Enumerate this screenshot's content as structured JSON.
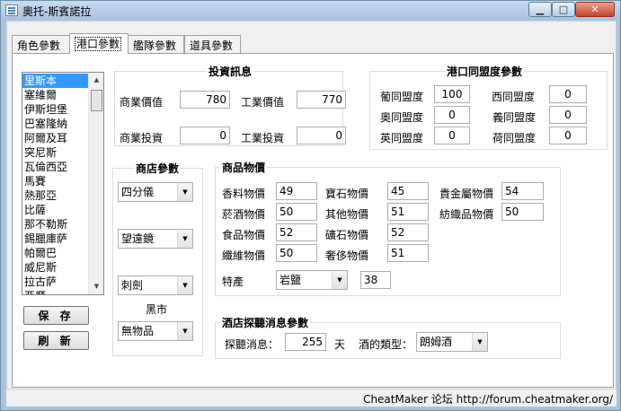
{
  "window": {
    "title": "奧托-斯賓諾拉"
  },
  "status": {
    "text": "CheatMaker 论坛 http://forum.cheatmaker.org/"
  },
  "tabs": [
    {
      "label": "角色參數"
    },
    {
      "label": "港口參數"
    },
    {
      "label": "艦隊參數"
    },
    {
      "label": "道具參數"
    }
  ],
  "ports": [
    "里斯本",
    "塞維爾",
    "伊斯坦堡",
    "巴塞隆納",
    "阿爾及耳",
    "突尼斯",
    "瓦倫西亞",
    "馬賽",
    "熱那亞",
    "比薩",
    "那不勒斯",
    "錫臘庫萨",
    "帕爾巴",
    "威尼斯",
    "拉古萨",
    "亞歷"
  ],
  "buttons": {
    "save": "保 存",
    "refresh": "刷 新"
  },
  "investment": {
    "title": "投資訊息",
    "commerce_value_label": "商業價值",
    "commerce_value": "780",
    "industry_value_label": "工業價值",
    "industry_value": "770",
    "commerce_invest_label": "商業投資",
    "commerce_invest": "0",
    "industry_invest_label": "工業投資",
    "industry_invest": "0"
  },
  "alliance": {
    "title": "港口同盟度參數",
    "por_label": "葡同盟度",
    "por": "100",
    "esp_label": "西同盟度",
    "esp": "0",
    "ott_label": "奧同盟度",
    "ott": "0",
    "ita_label": "義同盟度",
    "ita": "0",
    "eng_label": "英同盟度",
    "eng": "0",
    "ned_label": "荷同盟度",
    "ned": "0"
  },
  "shop": {
    "title": "商店參數",
    "item1": "四分儀",
    "item2": "望遠鏡",
    "item3": "刺劍",
    "black_market_label": "黑市",
    "black_market": "無物品"
  },
  "goods": {
    "title": "商品物價",
    "spice_label": "香料物價",
    "spice": "49",
    "gem_label": "寶石物價",
    "gem": "45",
    "metal_label": "貴金屬物價",
    "metal": "54",
    "liquor_label": "菸酒物價",
    "liquor": "50",
    "other_label": "其他物價",
    "other": "51",
    "textile_label": "紡織品物價",
    "textile": "50",
    "food_label": "食品物價",
    "food": "52",
    "mineral_label": "礦石物價",
    "mineral": "52",
    "fiber_label": "纖維物價",
    "fiber": "50",
    "luxury_label": "奢侈物價",
    "luxury": "51",
    "special_label": "特產",
    "special_item": "岩鹽",
    "special_price": "38"
  },
  "tavern": {
    "title": "酒店探聽消息參數",
    "news_label": "探聽消息：",
    "news_days": "255",
    "days_unit": "天",
    "drink_label": "酒的類型：",
    "drink": "朗姆酒"
  }
}
